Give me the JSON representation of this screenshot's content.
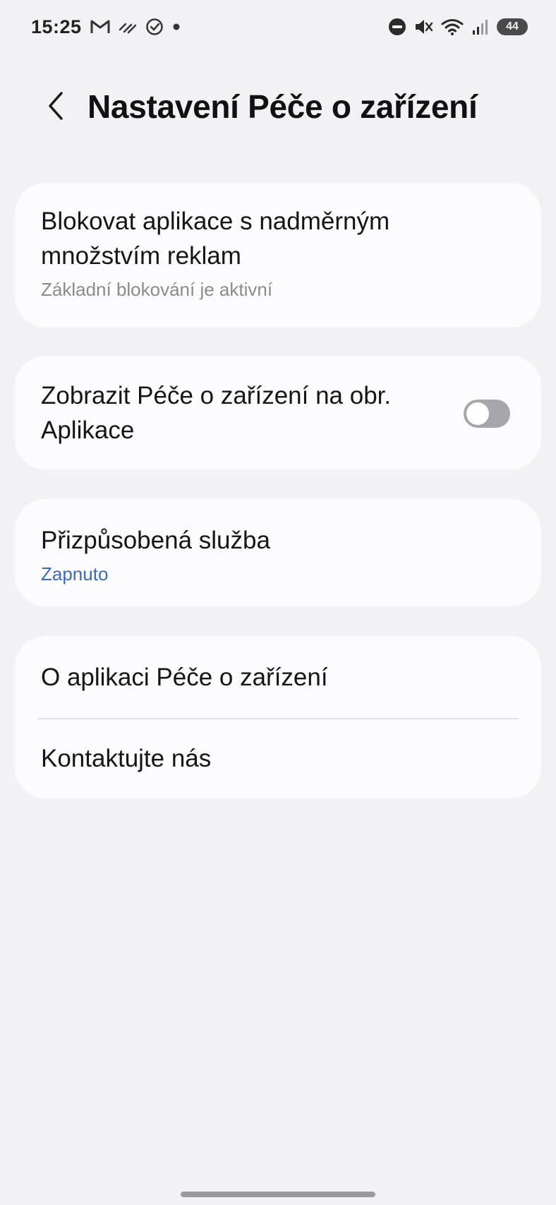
{
  "status_bar": {
    "time": "15:25",
    "left_icons": [
      "gmail-icon",
      "stripes-icon",
      "check-circle-icon",
      "dot-icon"
    ],
    "right_icons": [
      "do-not-disturb-icon",
      "mute-icon",
      "wifi-icon",
      "signal-icon"
    ],
    "battery": "44"
  },
  "header": {
    "title": "Nastavení Péče o zařízení",
    "back_icon": "chevron-left-icon"
  },
  "settings": {
    "block_ads": {
      "title": "Blokovat aplikace s nadměrným množstvím reklam",
      "subtitle": "Základní blokování je aktivní"
    },
    "show_on_apps": {
      "title": "Zobrazit Péče o zařízení na obr. Aplikace",
      "toggle_on": false
    },
    "custom_service": {
      "title": "Přizpůsobená služba",
      "subtitle": "Zapnuto"
    },
    "about": {
      "title": "O aplikaci Péče o zařízení"
    },
    "contact": {
      "title": "Kontaktujte nás"
    }
  },
  "colors": {
    "background": "#f2f2f4",
    "card": "#fcfcfe",
    "accent_blue": "#3d6ab8",
    "toggle_off": "#a7a7ab"
  }
}
